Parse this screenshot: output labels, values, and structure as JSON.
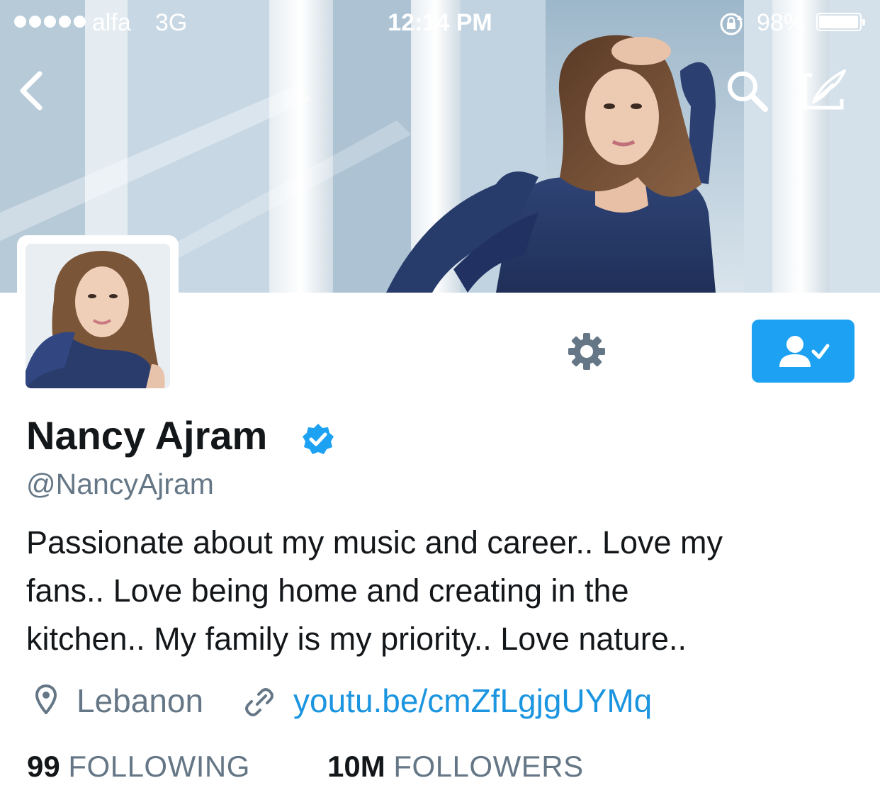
{
  "status_bar": {
    "carrier": "alfa",
    "network": "3G",
    "time": "12:14 PM",
    "battery_percent": "98%",
    "battery_level": 0.98
  },
  "nav": {
    "back_icon": "chevron-left-icon",
    "search_icon": "search-icon",
    "compose_icon": "compose-icon"
  },
  "profile": {
    "display_name": "Nancy Ajram",
    "verified": true,
    "handle": "@NancyAjram",
    "bio_lines": [
      "Passionate about my music and career.. Love my",
      "fans.. Love being home and creating in the",
      "kitchen.. My family is my priority.. Love nature.."
    ],
    "location": "Lebanon",
    "website": "youtu.be/cmZfLgjgUYMq"
  },
  "stats": {
    "following_count": "99",
    "following_label": "FOLLOWING",
    "followers_count": "10M",
    "followers_label": "FOLLOWERS"
  },
  "colors": {
    "accent": "#1da1f2",
    "link": "#1b95e0",
    "secondary_text": "#657786",
    "primary_text": "#14171a"
  }
}
